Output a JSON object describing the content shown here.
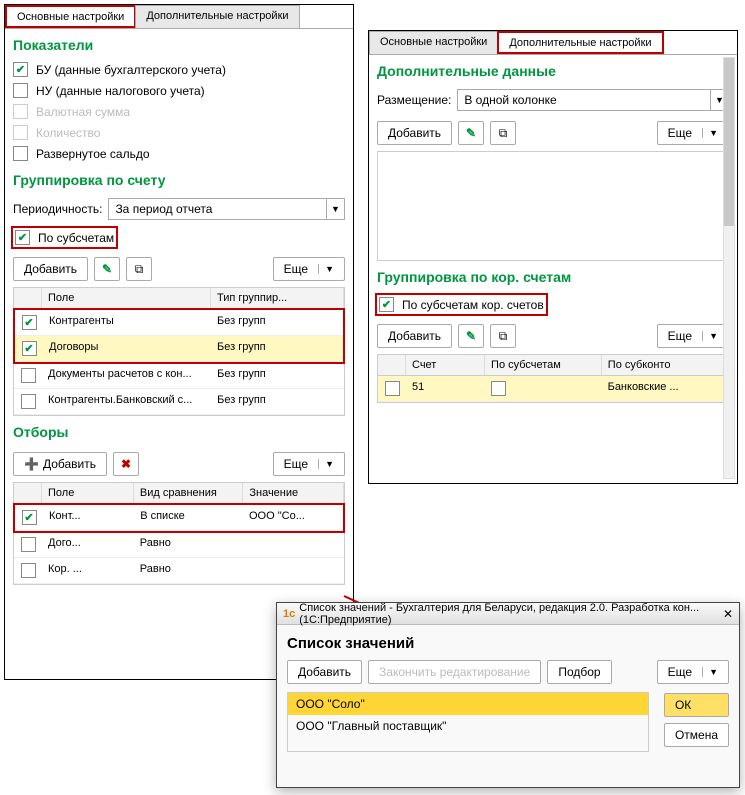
{
  "left": {
    "tabs": {
      "main": "Основные настройки",
      "extra": "Дополнительные настройки"
    },
    "indicators": {
      "title": "Показатели",
      "bu": "БУ (данные бухгалтерского учета)",
      "nu": "НУ (данные налогового учета)",
      "val": "Валютная сумма",
      "qty": "Количество",
      "saldo": "Развернутое сальдо"
    },
    "grouping": {
      "title": "Группировка по счету",
      "period_label": "Периодичность:",
      "period_value": "За период отчета",
      "by_sub": "По субсчетам",
      "add": "Добавить",
      "more": "Еще",
      "headers": {
        "field": "Поле",
        "type": "Тип группир..."
      },
      "rows": [
        {
          "field": "Контрагенты",
          "type": "Без групп",
          "checked": true
        },
        {
          "field": "Договоры",
          "type": "Без групп",
          "checked": true
        },
        {
          "field": "Документы расчетов с кон...",
          "type": "Без групп",
          "checked": false
        },
        {
          "field": "Контрагенты.Банковский с...",
          "type": "Без групп",
          "checked": false
        }
      ]
    },
    "filters": {
      "title": "Отборы",
      "add": "Добавить",
      "more": "Еще",
      "headers": {
        "field": "Поле",
        "cmp": "Вид сравнения",
        "val": "Значение"
      },
      "rows": [
        {
          "field": "Конт...",
          "cmp": "В списке",
          "val": "ООО \"Со...",
          "checked": true
        },
        {
          "field": "Дого...",
          "cmp": "Равно",
          "val": "",
          "checked": false
        },
        {
          "field": "Кор. ...",
          "cmp": "Равно",
          "val": "",
          "checked": false
        }
      ]
    }
  },
  "right": {
    "tabs": {
      "main": "Основные настройки",
      "extra": "Дополнительные настройки"
    },
    "extra_data": {
      "title": "Дополнительные данные",
      "placement_label": "Размещение:",
      "placement_value": "В одной колонке",
      "add": "Добавить",
      "more": "Еще"
    },
    "kor": {
      "title": "Группировка по кор. счетам",
      "by_sub": "По субсчетам кор. счетов",
      "add": "Добавить",
      "more": "Еще",
      "headers": {
        "acc": "Счет",
        "sub": "По субсчетам",
        "subk": "По субконто"
      },
      "row": {
        "acc": "51",
        "subk": "Банковские ..."
      }
    }
  },
  "dialog": {
    "title": "Список значений - Бухгалтерия для Беларуси, редакция 2.0. Разработка кон...   (1С:Предприятие)",
    "heading": "Список значений",
    "add": "Добавить",
    "finish": "Закончить редактирование",
    "pick": "Подбор",
    "more": "Еще",
    "ok": "ОК",
    "cancel": "Отмена",
    "items": [
      "ООО \"Соло\"",
      "ООО \"Главный поставщик\""
    ]
  },
  "icons": {
    "1c": "1с"
  }
}
